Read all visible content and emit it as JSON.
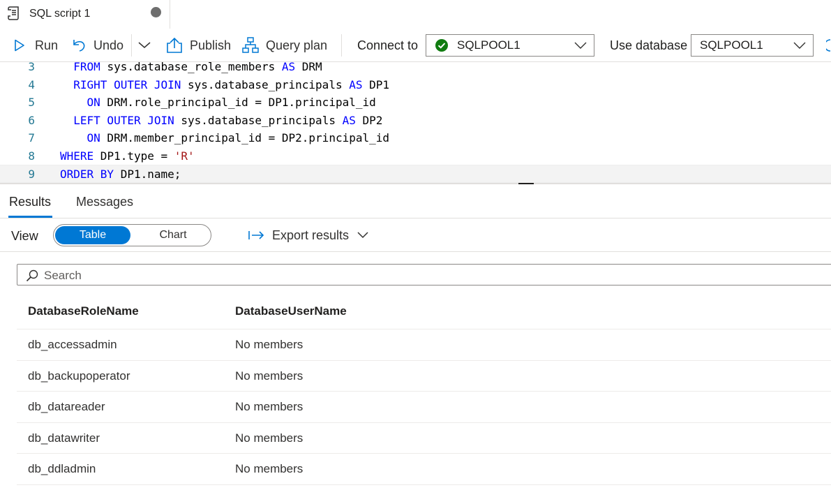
{
  "tab": {
    "title": "SQL script 1"
  },
  "toolbar": {
    "run": "Run",
    "undo": "Undo",
    "publish": "Publish",
    "query_plan": "Query plan",
    "connect_to_label": "Connect to",
    "connect_to_value": "SQLPOOL1",
    "use_database_label": "Use database",
    "use_database_value": "SQLPOOL1"
  },
  "editor": {
    "lines": [
      {
        "num": "3",
        "parts": [
          {
            "t": "  FROM ",
            "k": "kw"
          },
          {
            "t": "sys.database_role_members ",
            "k": ""
          },
          {
            "t": "AS",
            "k": "kw"
          },
          {
            "t": " DRM",
            "k": ""
          }
        ]
      },
      {
        "num": "4",
        "parts": [
          {
            "t": "  RIGHT OUTER JOIN",
            "k": "kw"
          },
          {
            "t": " sys.database_principals ",
            "k": ""
          },
          {
            "t": "AS",
            "k": "kw"
          },
          {
            "t": " DP1",
            "k": ""
          }
        ]
      },
      {
        "num": "5",
        "parts": [
          {
            "t": "    ON",
            "k": "kw"
          },
          {
            "t": " DRM.role_principal_id = DP1.principal_id",
            "k": ""
          }
        ]
      },
      {
        "num": "6",
        "parts": [
          {
            "t": "  LEFT OUTER JOIN",
            "k": "kw"
          },
          {
            "t": " sys.database_principals ",
            "k": ""
          },
          {
            "t": "AS",
            "k": "kw"
          },
          {
            "t": " DP2",
            "k": ""
          }
        ]
      },
      {
        "num": "7",
        "parts": [
          {
            "t": "    ON",
            "k": "kw"
          },
          {
            "t": " DRM.member_principal_id = DP2.principal_id",
            "k": ""
          }
        ]
      },
      {
        "num": "8",
        "parts": [
          {
            "t": "WHERE",
            "k": "kw"
          },
          {
            "t": " DP1.type = ",
            "k": ""
          },
          {
            "t": "'R'",
            "k": "str"
          }
        ]
      },
      {
        "num": "9",
        "parts": [
          {
            "t": "ORDER BY",
            "k": "kw"
          },
          {
            "t": " DP1.name;",
            "k": ""
          }
        ]
      }
    ]
  },
  "results": {
    "tabs": [
      "Results",
      "Messages"
    ],
    "view_label": "View",
    "view_options": [
      "Table",
      "Chart"
    ],
    "export_label": "Export results",
    "search_placeholder": "Search",
    "columns": [
      "DatabaseRoleName",
      "DatabaseUserName"
    ],
    "rows": [
      [
        "db_accessadmin",
        "No members"
      ],
      [
        "db_backupoperator",
        "No members"
      ],
      [
        "db_datareader",
        "No members"
      ],
      [
        "db_datawriter",
        "No members"
      ],
      [
        "db_ddladmin",
        "No members"
      ]
    ]
  },
  "colors": {
    "accent": "#0078d4",
    "connected": "#107c10",
    "keyword": "#0000ff",
    "string": "#a31515",
    "line_number": "#237893"
  }
}
